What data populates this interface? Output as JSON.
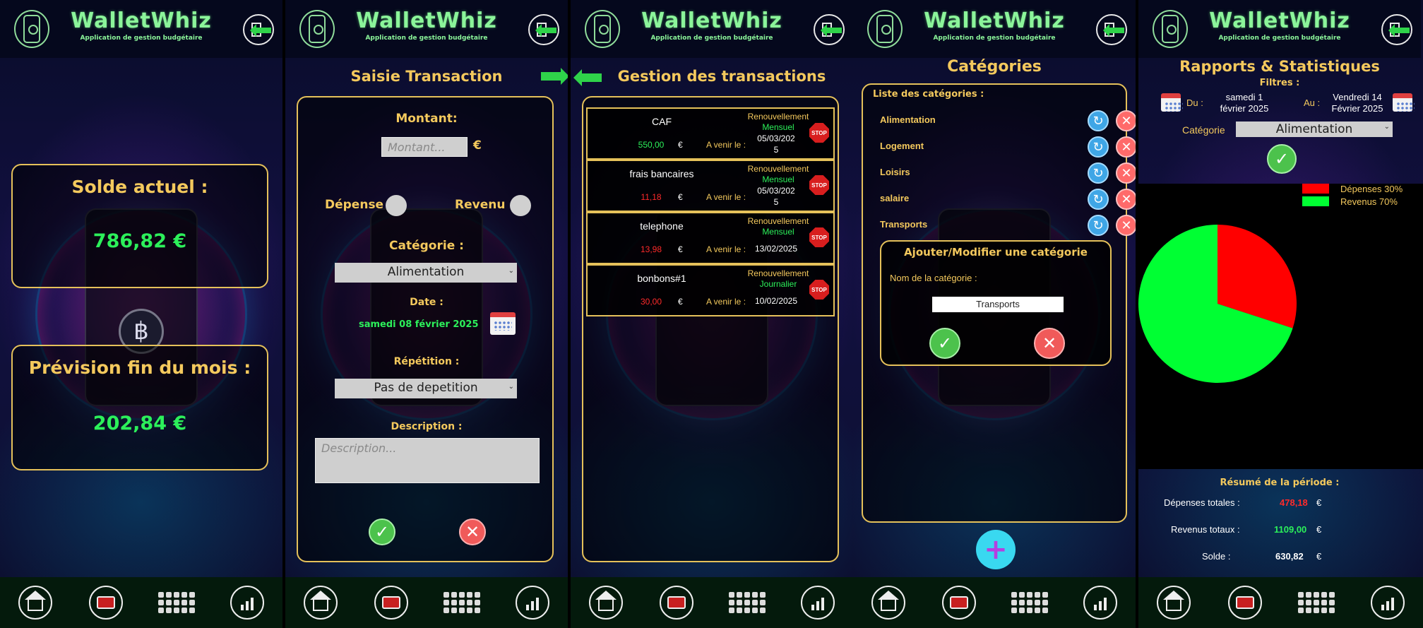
{
  "app": {
    "title": "WalletWhiz",
    "subtitle": "Application de gestion budgétaire"
  },
  "colors": {
    "accent_gold": "#f4c95d",
    "brand_green": "#8bf59a",
    "positive": "#2cf05a",
    "negative": "#ff2a2a",
    "panel_border": "#e5c15a"
  },
  "icons": {
    "logo": "wallet-phone-logo-icon",
    "logout": "logout-icon",
    "nav": [
      "home-icon",
      "card-transaction-icon",
      "category-grid-icon",
      "stats-chart-icon"
    ]
  },
  "dashboard": {
    "balance_label": "Solde actuel :",
    "balance_value": "786,82 €",
    "forecast_label": "Prévision fin du mois :",
    "forecast_value": "202,84 €"
  },
  "entry": {
    "title": "Saisie Transaction",
    "amount_label": "Montant:",
    "amount_placeholder": "Montant...",
    "currency": "€",
    "expense_label": "Dépense",
    "income_label": "Revenu",
    "category_label": "Catégorie :",
    "category_value": "Alimentation",
    "date_label": "Date :",
    "date_value": "samedi 08 février 2025",
    "repeat_label": "Répétition :",
    "repeat_value": "Pas de depetition",
    "description_label": "Description :",
    "description_placeholder": "Description..."
  },
  "transactions": {
    "title": "Gestion des transactions",
    "renew_label": "Renouvellement",
    "upcoming_label": "A venir le :",
    "currency": "€",
    "stop_label": "STOP",
    "items": [
      {
        "name": "CAF",
        "amount": "550,00",
        "type": "income",
        "frequency": "Mensuel",
        "date_line1": "05/03/202",
        "date_line2": "5"
      },
      {
        "name": "frais bancaires",
        "amount": "11,18",
        "type": "expense",
        "frequency": "Mensuel",
        "date_line1": "05/03/202",
        "date_line2": "5"
      },
      {
        "name": "telephone",
        "amount": "13,98",
        "type": "expense",
        "frequency": "Mensuel",
        "date_line1": "13/02/2025",
        "date_line2": ""
      },
      {
        "name": "bonbons#1",
        "amount": "30,00",
        "type": "expense",
        "frequency": "Journalier",
        "date_line1": "10/02/2025",
        "date_line2": ""
      }
    ]
  },
  "categories": {
    "title": "Catégories",
    "list_label": "Liste des catégories :",
    "items": [
      "Alimentation",
      "Logement",
      "Loisirs",
      "salaire",
      "Transports"
    ],
    "form_title": "Ajouter/Modifier une catégorie",
    "name_label": "Nom de la catégorie :",
    "name_value": "Transports"
  },
  "reports": {
    "title": "Rapports & Statistiques",
    "filters_label": "Filtres :",
    "from_label": "Du :",
    "from_line1": "samedi 1",
    "from_line2": "février 2025",
    "to_label": "Au :",
    "to_line1": "Vendredi 14",
    "to_line2": "Février 2025",
    "category_label": "Catégorie",
    "category_value": "Alimentation",
    "summary_title": "Résumé de la période :",
    "total_expense_label": "Dépenses totales :",
    "total_expense_value": "478,18",
    "total_income_label": "Revenus totaux :",
    "total_income_value": "1109,00",
    "balance_label": "Solde :",
    "balance_value": "630,82",
    "currency": "€"
  },
  "chart_data": {
    "type": "pie",
    "labels": [
      "Dépenses 30%",
      "Revenus 70%"
    ],
    "values": [
      30,
      70
    ],
    "colors": [
      "#ff0000",
      "#00ff33"
    ],
    "legend_placement": "top-right"
  }
}
